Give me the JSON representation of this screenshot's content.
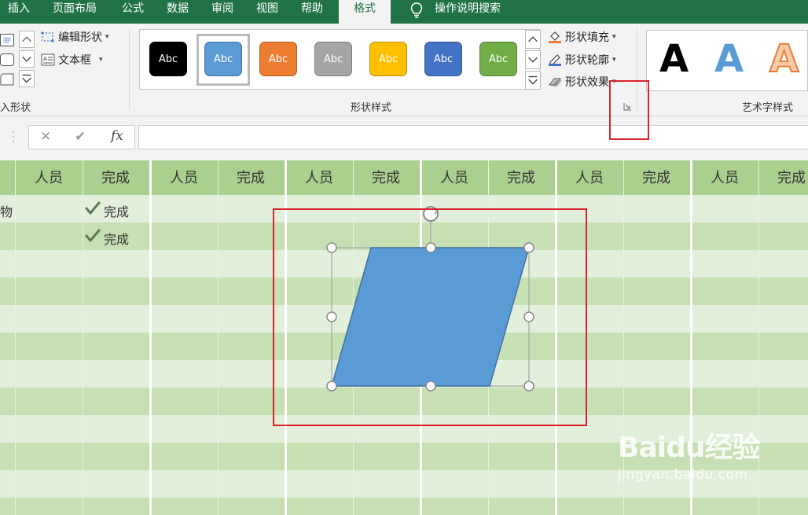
{
  "ribbon_tabs": [
    "插入",
    "页面布局",
    "公式",
    "数据",
    "审阅",
    "视图",
    "帮助"
  ],
  "active_tab": "格式",
  "tell_me": "操作说明搜索",
  "insert_shapes": {
    "edit_shape_label": "编辑形状",
    "text_box_label": "文本框",
    "group_label": "入形状"
  },
  "shape_styles": {
    "group_label": "形状样式",
    "swatches": [
      {
        "label": "Abc",
        "color": "#000000"
      },
      {
        "label": "Abc",
        "color": "#5b9bd5"
      },
      {
        "label": "Abc",
        "color": "#ed7d31"
      },
      {
        "label": "Abc",
        "color": "#a5a5a5"
      },
      {
        "label": "Abc",
        "color": "#ffc000"
      },
      {
        "label": "Abc",
        "color": "#4472c4"
      },
      {
        "label": "Abc",
        "color": "#70ad47"
      }
    ],
    "selected_index": 1,
    "fill_label": "形状填充",
    "outline_label": "形状轮廓",
    "effects_label": "形状效果"
  },
  "wordart": {
    "group_label": "艺术字样式",
    "letters": [
      {
        "text": "A",
        "color": "#000000"
      },
      {
        "text": "A",
        "color": "#5b9bd5"
      },
      {
        "text": "A",
        "color": "#ed7d31"
      }
    ]
  },
  "formula_bar": {
    "cancel_symbol": "✕",
    "enter_symbol": "✔",
    "fx_label": "fx",
    "value": ""
  },
  "sheet": {
    "headers": [
      "人员",
      "完成",
      "人员",
      "完成",
      "人员",
      "完成",
      "人员",
      "完成",
      "人员",
      "完成",
      "人员",
      "完成"
    ],
    "row1_col0_text": "物",
    "row1_status": "完成",
    "row2_status": "完成"
  },
  "colors": {
    "ribbon_green": "#217346",
    "sheet_header": "#a9d08e",
    "sheet_dark_band": "#c6e0b4",
    "sheet_light_band": "#e2efda",
    "shape_fill": "#5b9bd5",
    "annotation_red": "#d9232b"
  },
  "watermark": {
    "main": "Baidu经验",
    "sub": "jingyan.baidu.com"
  }
}
